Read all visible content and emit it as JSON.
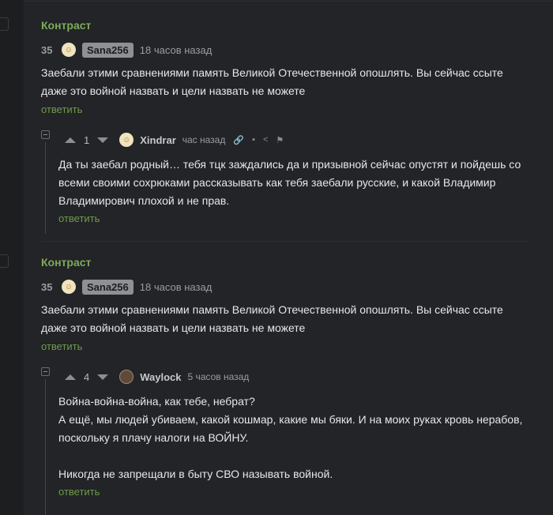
{
  "comments": [
    {
      "section_title": "Контраст",
      "rating": "35",
      "avatar_glyph": "☺",
      "author": "Sana256",
      "time": "18 часов назад",
      "text": "Заебали этими сравнениями память Великой Отечественной опошлять. Вы сейчас ссыте даже это войной назвать и цели назвать не можете",
      "reply_label": "ответить",
      "reply": {
        "votes": "1",
        "avatar_glyph": "☺",
        "author": "Xindrar",
        "time": "час назад",
        "tool_icons": [
          "link-icon",
          "save-icon",
          "share-icon",
          "flag-icon"
        ],
        "text": "Да ты заебал родный… тебя тцк заждались да и призывной сейчас опустят и пойдешь со всеми своими сохрюками рассказывать как тебя заебали русские, и какой Владимир Владимирович плохой и не прав.",
        "reply_label": "ответить"
      }
    },
    {
      "section_title": "Контраст",
      "rating": "35",
      "avatar_glyph": "☺",
      "author": "Sana256",
      "time": "18 часов назад",
      "text": "Заебали этими сравнениями память Великой Отечественной опошлять. Вы сейчас ссыте даже это войной назвать и цели назвать не можете",
      "reply_label": "ответить",
      "reply": {
        "votes": "4",
        "author": "Waylock",
        "time": "5 часов назад",
        "lines": [
          "Война-война-война, как тебе, небрат?",
          "А ещё, мы людей убиваем, какой кошмар, какие мы бяки. И на моих руках кровь нерабов, поскольку я плачу налоги на ВОЙНУ.",
          "Никогда не запрещали в быту СВО называть войной."
        ],
        "reply_label": "ответить"
      }
    }
  ]
}
